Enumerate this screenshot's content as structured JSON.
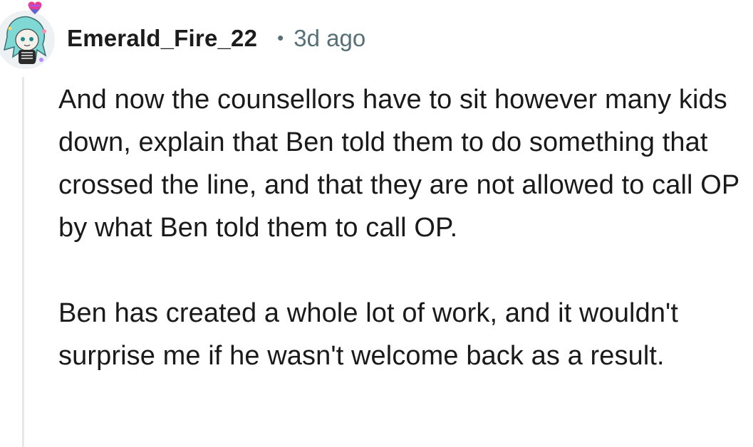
{
  "comment": {
    "username": "Emerald_Fire_22",
    "separator": "•",
    "timestamp": "3d ago",
    "avatar_icon": "snoo-avatar-icon",
    "badge_icon": "heart-badge-icon",
    "paragraphs": [
      "And now the counsellors have to sit however many kids down, explain that Ben told them to do something that crossed the line, and that they are not allowed to call OP by what Ben told them to call OP.",
      "Ben has created a whole lot of work, and it wouldn't surprise me if he wasn't welcome back as a result."
    ]
  },
  "colors": {
    "username": "#1c1c1c",
    "meta": "#576f76",
    "body": "#1a1a1b",
    "thread_line": "#e5e7e9",
    "heart_top": "#e83e8c",
    "heart_bottom": "#4d6bdc"
  }
}
